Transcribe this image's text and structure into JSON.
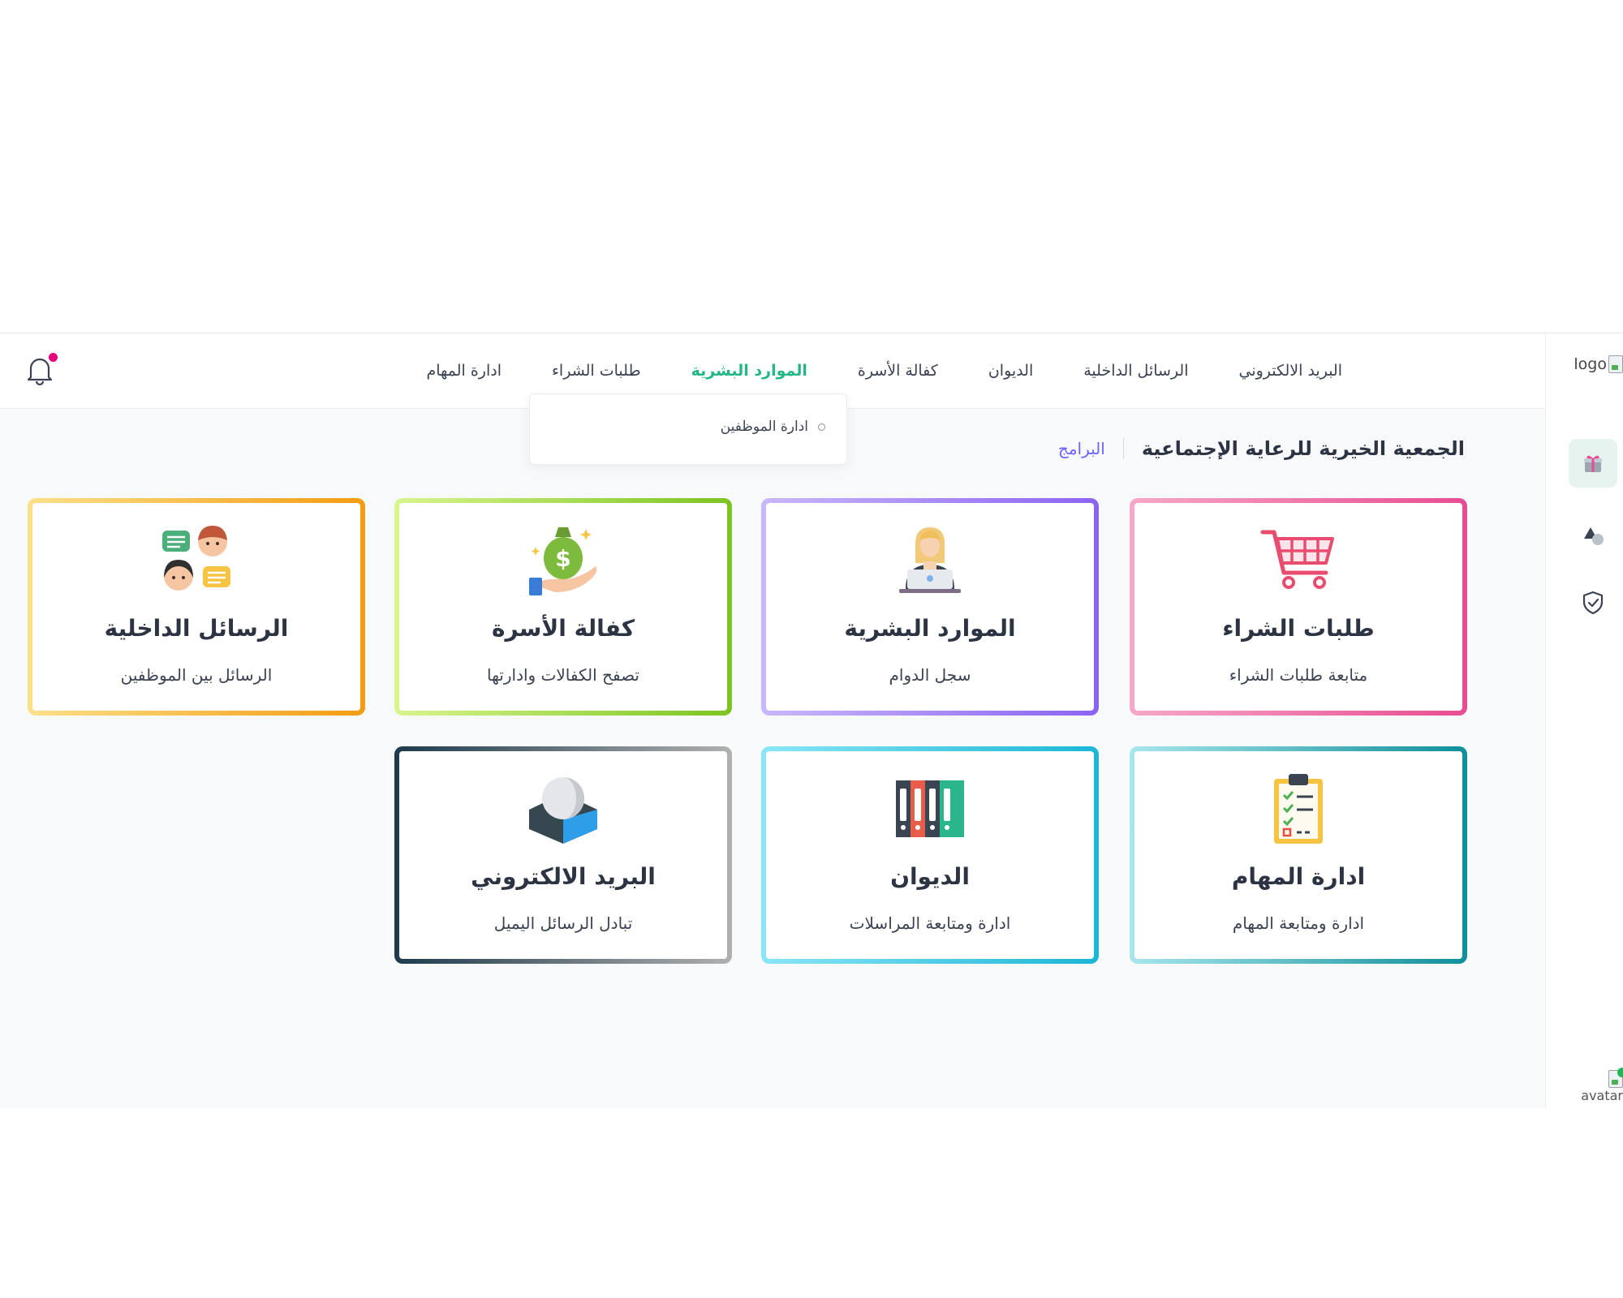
{
  "sidebar": {
    "logo_alt": "logo",
    "avatar_alt": "avatar"
  },
  "nav": {
    "items": [
      "البريد الالكتروني",
      "الرسائل الداخلية",
      "الديوان",
      "كفالة الأسرة",
      "الموارد البشرية",
      "طلبات الشراء",
      "ادارة المهام"
    ],
    "active": "الموارد البشرية"
  },
  "dropdown": {
    "items": [
      "ادارة الموظفين"
    ]
  },
  "breadcrumb": {
    "org": "الجمعية الخيرية للرعاية الإجتماعية",
    "current": "البرامج"
  },
  "cards": [
    {
      "title": "طلبات الشراء",
      "subtitle": "متابعة طلبات الشراء",
      "icon": "shopping-cart-icon",
      "colors": [
        "#f6a8c8",
        "#e84c93"
      ]
    },
    {
      "title": "الموارد البشرية",
      "subtitle": "سجل الدوام",
      "icon": "employee-laptop-icon",
      "colors": [
        "#c9b8fb",
        "#8c62f0"
      ]
    },
    {
      "title": "كفالة الأسرة",
      "subtitle": "تصفح الكفالات وادارتها",
      "icon": "money-bag-hand-icon",
      "colors": [
        "#d8f58e",
        "#7cc421"
      ]
    },
    {
      "title": "الرسائل الداخلية",
      "subtitle": "الرسائل بين الموظفين",
      "icon": "chat-people-icon",
      "colors": [
        "#fbe08a",
        "#f39c12"
      ]
    },
    {
      "title": "ادارة المهام",
      "subtitle": "ادارة ومتابعة المهام",
      "icon": "task-clipboard-icon",
      "colors": [
        "#a8e6ec",
        "#0f8f9a"
      ]
    },
    {
      "title": "الديوان",
      "subtitle": "ادارة ومتابعة المراسلات",
      "icon": "binders-icon",
      "colors": [
        "#8ae6f6",
        "#1bb6d6"
      ]
    },
    {
      "title": "البريد الالكتروني",
      "subtitle": "تبادل الرسائل اليميل",
      "icon": "roundcube-mail-icon",
      "colors": [
        "#1e3a4c",
        "#b0b0b0"
      ]
    }
  ]
}
